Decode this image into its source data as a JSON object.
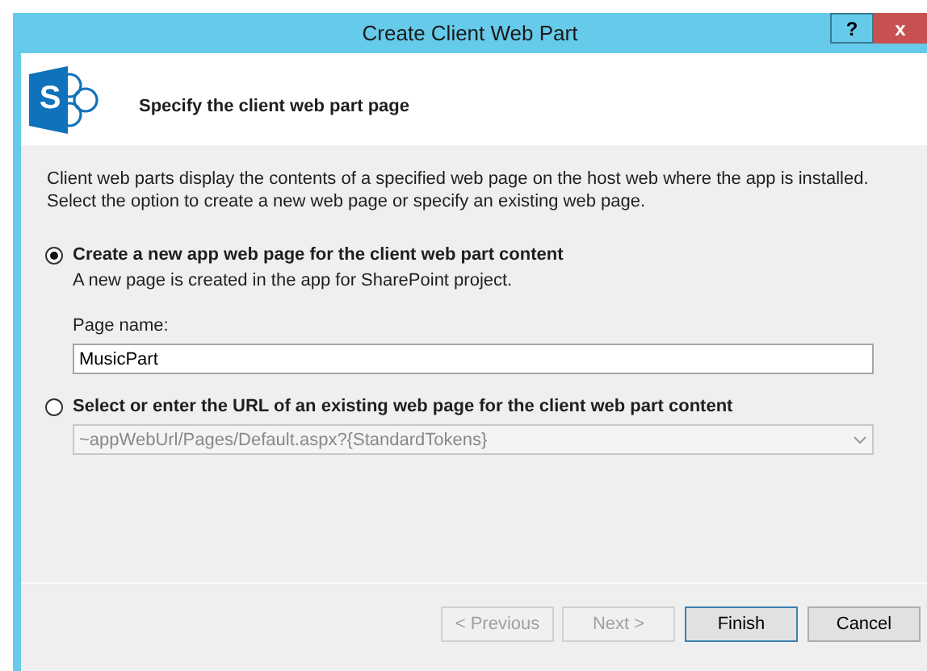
{
  "window": {
    "title": "Create Client Web Part",
    "buttons": [
      {
        "label": "?",
        "kind": "help"
      },
      {
        "label": "x",
        "kind": "close"
      }
    ]
  },
  "header": {
    "logo_letter": "S",
    "title": "Specify the client web part page"
  },
  "description": "Client web parts display the contents of a specified web page on the host web where the app is installed. Select the option to create a new web page or specify an existing web page.",
  "options": [
    {
      "label": "Create a new app web page for the client web part content",
      "selected": true,
      "description": "A new page is created in the app for SharePoint project.",
      "field": {
        "kind": "text",
        "label": "Page name:",
        "value": "MusicPart",
        "disabled": false
      }
    },
    {
      "label": "Select or enter the URL of an existing web page for the client web part content",
      "selected": false,
      "field": {
        "kind": "combo",
        "value": "~appWebUrl/Pages/Default.aspx?{StandardTokens}",
        "disabled": true
      }
    }
  ],
  "buttons": [
    {
      "label": "< Previous",
      "disabled": true,
      "default": false
    },
    {
      "label": "Next >",
      "disabled": true,
      "default": false
    },
    {
      "label": "Finish",
      "disabled": false,
      "default": true
    },
    {
      "label": "Cancel",
      "disabled": false,
      "default": false
    }
  ]
}
